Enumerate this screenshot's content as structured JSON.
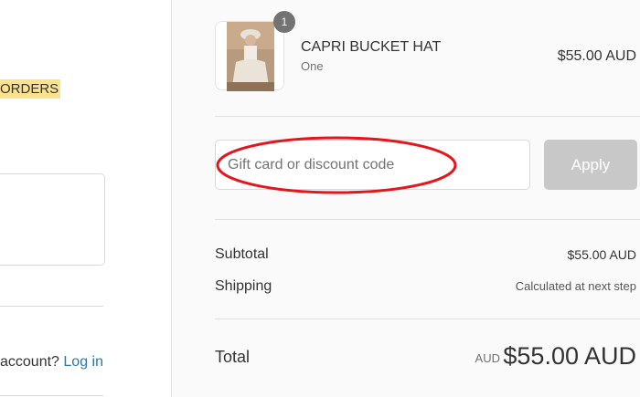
{
  "left": {
    "orders_text": "ORDERS",
    "login_prompt": "account?",
    "login_link": "Log in"
  },
  "product": {
    "name": "CAPRI BUCKET HAT",
    "variant": "One",
    "price": "$55.00 AUD",
    "quantity": "1"
  },
  "discount": {
    "placeholder": "Gift card or discount code",
    "apply_label": "Apply"
  },
  "totals": {
    "subtotal_label": "Subtotal",
    "subtotal_value": "$55.00 AUD",
    "shipping_label": "Shipping",
    "shipping_value": "Calculated at next step",
    "total_label": "Total",
    "currency": "AUD",
    "total_value": "$55.00 AUD"
  },
  "colors": {
    "highlight_yellow": "#fde28d",
    "annotation_red": "#e8141c",
    "apply_disabled": "#c8c8c8",
    "link_blue": "#2a79a6"
  }
}
